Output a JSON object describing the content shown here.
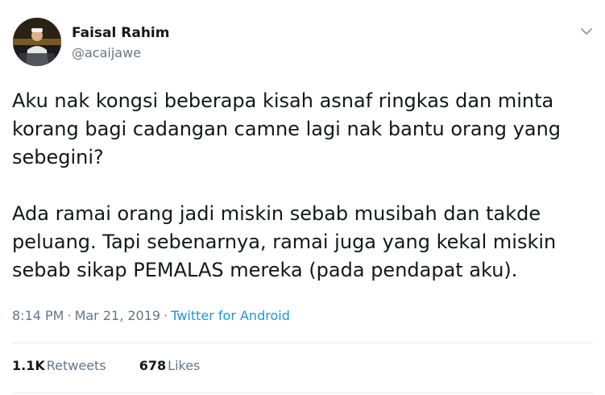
{
  "author": {
    "display_name": "Faisal Rahim",
    "handle": "@acaijawe",
    "avatar_icon": "profile-avatar"
  },
  "menu": {
    "icon": "chevron-down-icon"
  },
  "tweet": {
    "paragraph1": [
      "Aku nak kongsi beberapa kisah asnaf ringkas dan minta",
      "korang bagi cadangan camne lagi nak bantu orang yang",
      "sebegini?"
    ],
    "paragraph2": [
      "Ada ramai orang jadi miskin sebab musibah dan takde",
      "peluang. Tapi sebenarnya, ramai juga yang kekal miskin",
      "sebab sikap PEMALAS mereka (pada pendapat aku)."
    ]
  },
  "meta": {
    "time": "8:14 PM",
    "separator": "·",
    "date": "Mar 21, 2019",
    "source": "Twitter for Android"
  },
  "stats": {
    "retweets_count": "1.1K",
    "retweets_label": "Retweets",
    "likes_count": "678",
    "likes_label": "Likes"
  },
  "colors": {
    "text": "#14171a",
    "secondary": "#657786",
    "link": "#1b95e0",
    "divider": "#e6ecf0"
  }
}
